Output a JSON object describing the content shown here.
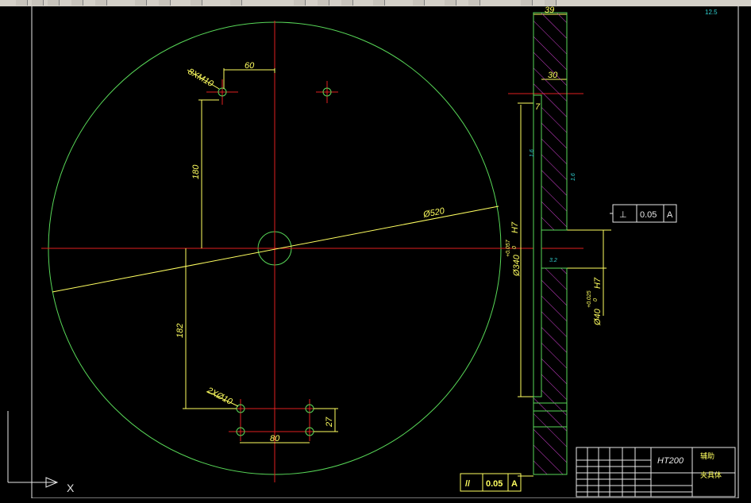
{
  "drawing": {
    "dims": {
      "tap_holes": "8XM10",
      "top_horiz": "60",
      "vert_upper": "180",
      "vert_lower": "182",
      "diameter": "Ø520",
      "pin_holes": "2XØ10",
      "bottom_horiz": "80",
      "right_vert": "27",
      "thickness": "39",
      "step": "30",
      "recess": "7",
      "bore_outer": "Ø340",
      "bore_outer_tol": "+0.057",
      "bore_outer_tol_low": "0",
      "bore_outer_fit": "H7",
      "bore_inner": "Ø40",
      "bore_inner_tol": "+0.025",
      "bore_inner_tol_low": "0",
      "bore_inner_fit": "H7",
      "rough_a": "1.6",
      "rough_b": "1.6",
      "rough_c": "3.2",
      "rough_global": "12.5"
    },
    "gdt_perp": {
      "symbol": "⊥",
      "value": "0.05",
      "datum": "A"
    },
    "gdt_para": {
      "symbol": "//",
      "value": "0.05",
      "datum": "A"
    },
    "title_block": {
      "material": "HT200",
      "name": "夹具体",
      "org": "辅助"
    },
    "axis_label": "X"
  },
  "colors": {
    "green": "#58d858",
    "red": "#e02020",
    "yellow": "#ffff60",
    "magenta": "#d040d0",
    "cyan": "#30d0d0",
    "white": "#e8e8e8"
  }
}
